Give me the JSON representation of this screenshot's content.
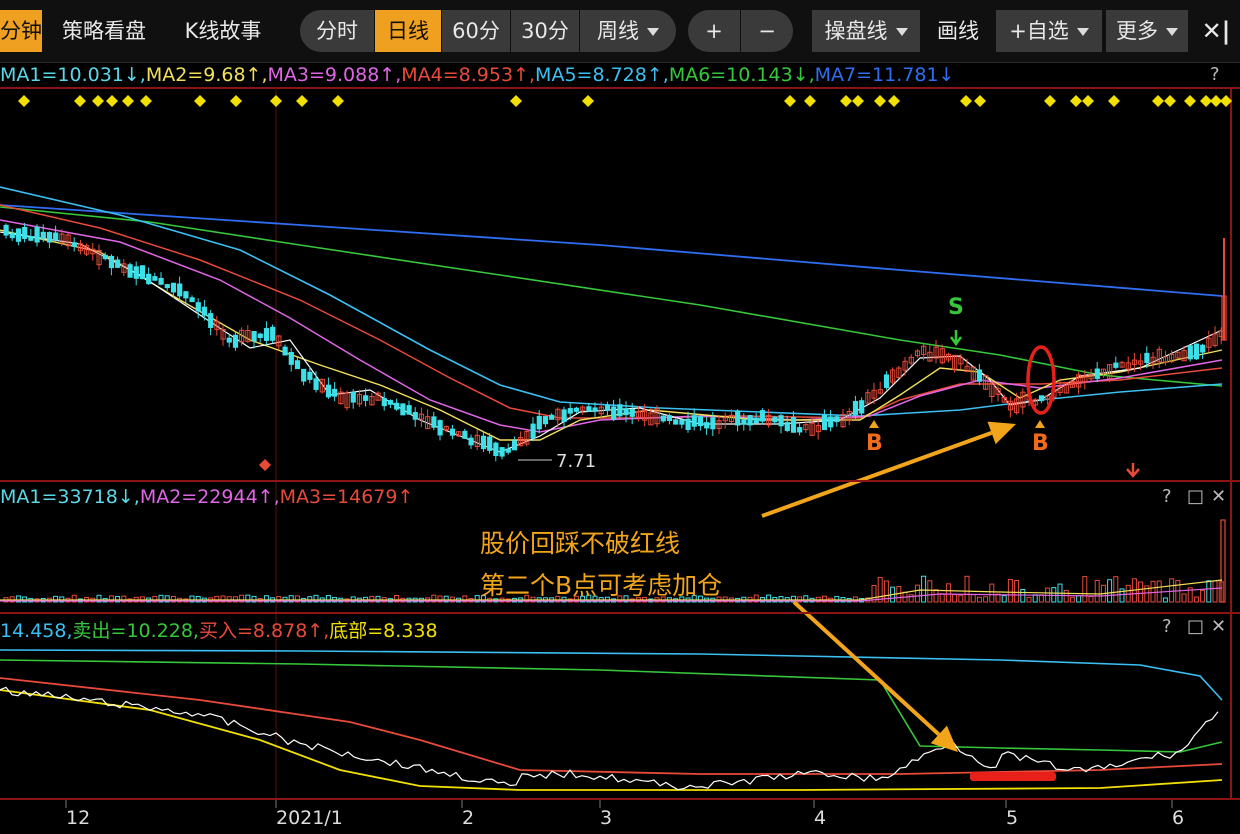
{
  "toolbar": {
    "items": [
      "分钟",
      "策略看盘",
      "K线故事",
      "分时",
      "日线",
      "60分",
      "30分",
      "周线",
      "+",
      "−",
      "操盘线",
      "画线",
      "+自选",
      "更多",
      "✕|"
    ],
    "active": "日线"
  },
  "colors": {
    "ma1": "#5ad8e8",
    "ma2": "#f2e05a",
    "ma3": "#e066e6",
    "ma4": "#e84a3a",
    "ma5": "#3ac0f2",
    "ma6": "#36c83a",
    "ma7": "#2f6ef2",
    "up": "#e84a3a",
    "down": "#3de0e8",
    "signal": "#f2e000",
    "arrow": "#f2a51b",
    "white_line": "#ffffff",
    "grid_red": "#8b1515"
  },
  "main_panel": {
    "header": [
      {
        "text": "MA1=10.031↓,",
        "color_key": "ma1"
      },
      {
        "text": "MA2=9.68↑,",
        "color_key": "ma2"
      },
      {
        "text": "MA3=9.088↑,",
        "color_key": "ma3"
      },
      {
        "text": "MA4=8.953↑,",
        "color_key": "ma4"
      },
      {
        "text": "MA5=8.728↑,",
        "color_key": "ma5"
      },
      {
        "text": "MA6=10.143↓,",
        "color_key": "ma6"
      },
      {
        "text": "MA7=11.781↓",
        "color_key": "ma7"
      }
    ],
    "help": "?",
    "low_label": "7.71",
    "sell_marker": "S",
    "buy_markers": [
      "B",
      "B"
    ]
  },
  "volume_panel": {
    "header": [
      {
        "text": "MA1=33718↓,",
        "color_key": "ma1"
      },
      {
        "text": "MA2=22944↑,",
        "color_key": "ma3"
      },
      {
        "text": "MA3=14679↑",
        "color_key": "ma4"
      }
    ],
    "controls": [
      "?",
      "□",
      "✕"
    ]
  },
  "indicator_panel": {
    "header": [
      {
        "text": "14.458,",
        "color_key": "ma5"
      },
      {
        "text": "卖出=10.228,",
        "color_key": "ma6"
      },
      {
        "text": "买入=8.878↑,",
        "color_key": "ma4"
      },
      {
        "text": "底部=8.338",
        "color_key": "signal"
      }
    ],
    "controls": [
      "?",
      "□",
      "✕"
    ]
  },
  "annotation": {
    "line1": "股价回踩不破红线",
    "line2": "第二个B点可考虑加仓"
  },
  "x_axis": {
    "labels": [
      "12",
      "2021/1",
      "2",
      "3",
      "4",
      "5",
      "6"
    ]
  },
  "chart_data": [
    {
      "type": "line",
      "title": "",
      "x_axis_labels": [
        "12",
        "2021/1",
        "2",
        "3",
        "4",
        "5",
        "6"
      ],
      "series": [
        {
          "name": "MA1",
          "last": 10.031
        },
        {
          "name": "MA2",
          "last": 9.68
        },
        {
          "name": "MA3",
          "last": 9.088
        },
        {
          "name": "MA4",
          "last": 8.953
        },
        {
          "name": "MA5",
          "last": 8.728
        },
        {
          "name": "MA6",
          "last": 10.143
        },
        {
          "name": "MA7",
          "last": 11.781
        }
      ],
      "annotations": [
        "7.71",
        "S",
        "B",
        "B"
      ]
    },
    {
      "type": "bar",
      "series": [
        {
          "name": "MA1",
          "last": 33718
        },
        {
          "name": "MA2",
          "last": 22944
        },
        {
          "name": "MA3",
          "last": 14679
        }
      ]
    },
    {
      "type": "line",
      "series": [
        {
          "name": "卖出",
          "last": 10.228
        },
        {
          "name": "买入",
          "last": 8.878
        },
        {
          "name": "底部",
          "last": 8.338
        }
      ]
    }
  ]
}
